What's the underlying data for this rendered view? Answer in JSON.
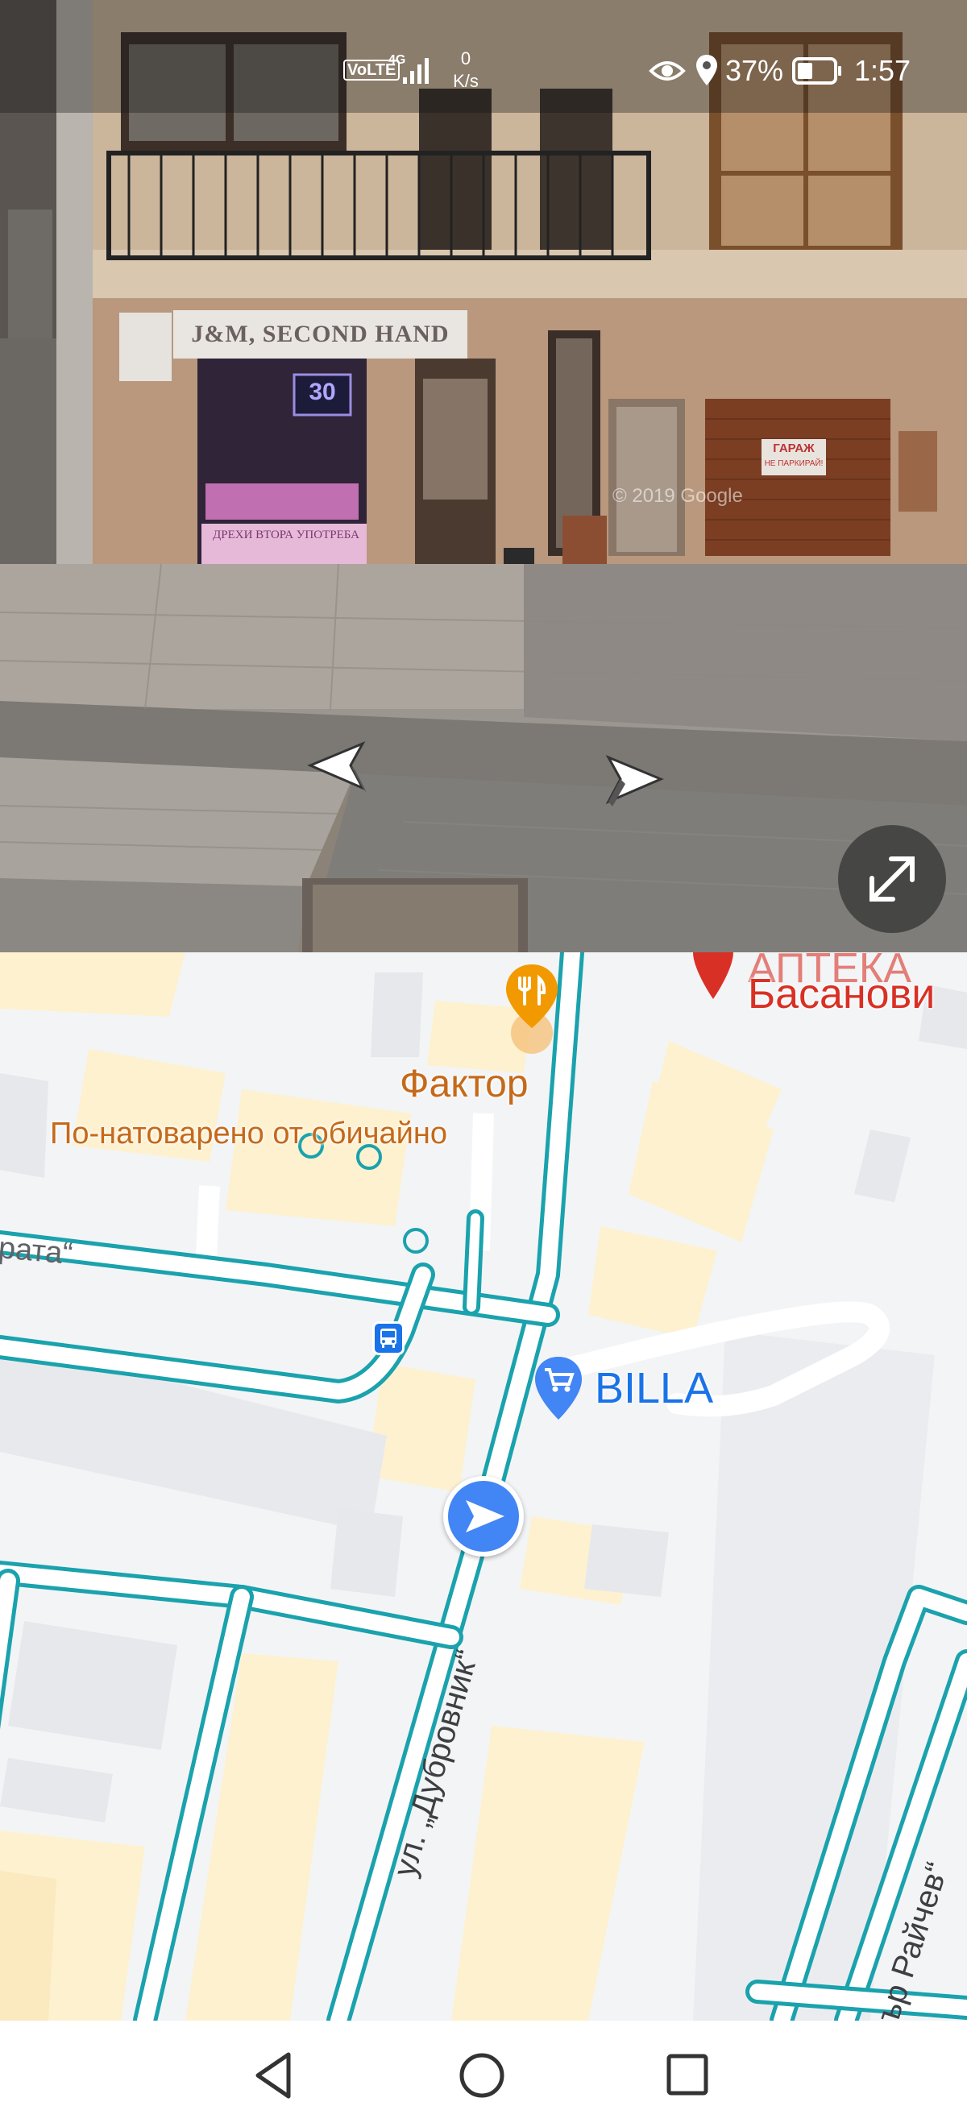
{
  "status_bar": {
    "network_label": "VoLTE",
    "network_gen": "4G",
    "speed_value": "0",
    "speed_unit": "K/s",
    "battery": "37%",
    "time": "1:57"
  },
  "street_view": {
    "shop_sign": "J&M, SECOND HAND",
    "shop_window_banner": "ДРЕХИ ВТОРА УПОТРЕБА",
    "price_tag": "30",
    "garage_sign_line1": "ГАРАЖ",
    "garage_sign_line2": "НЕ ПАРКИРАЙ!",
    "watermark": "© 2019 Google"
  },
  "map": {
    "poi_pharmacy_label": "Басанови",
    "poi_pharmacy_label_top": "АПТЕКА",
    "poi_restaurant_name": "Фактор",
    "poi_restaurant_status": "По-натоварено от обичайно",
    "poi_billa": "BILLA",
    "street_dubrovnik": "ул. „Дубровник“",
    "street_partial_left": "рата“",
    "street_raychev": "ър Райчев“"
  },
  "colors": {
    "road_outline": "#1aa2ad",
    "poi_orange": "#e8710a",
    "poi_red": "#d93025",
    "poi_blue": "#4285f4",
    "building_yellow": "#fdf1cf"
  },
  "icons": {
    "eye": "eye-icon",
    "location": "location-icon",
    "battery": "battery-icon",
    "signal": "signal-icon",
    "expand": "expand-icon",
    "back": "back-icon",
    "home": "home-icon",
    "recents": "recents-icon",
    "bus": "bus-stop-icon",
    "cart": "cart-icon",
    "fork_knife": "restaurant-icon",
    "navigation": "navigation-arrow-icon"
  }
}
